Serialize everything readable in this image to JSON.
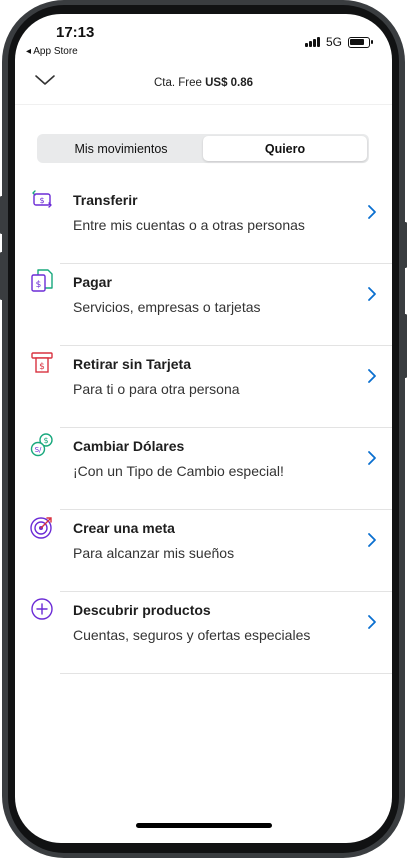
{
  "status_bar": {
    "time": "17:13",
    "back_app": "◂ App Store",
    "network": "5G"
  },
  "header": {
    "account_label": "Cta. Free",
    "account_amount": "US$ 0.86"
  },
  "tabs": [
    {
      "label": "Mis movimientos",
      "active": false
    },
    {
      "label": "Quiero",
      "active": true
    }
  ],
  "menu": [
    {
      "icon": "transfer-icon",
      "title": "Transferir",
      "subtitle": "Entre mis cuentas o a otras personas"
    },
    {
      "icon": "bill-icon",
      "title": "Pagar",
      "subtitle": "Servicios, empresas o tarjetas"
    },
    {
      "icon": "atm-icon",
      "title": "Retirar sin Tarjeta",
      "subtitle": "Para ti o para otra persona"
    },
    {
      "icon": "currency-exchange-icon",
      "title": "Cambiar Dólares",
      "subtitle": "¡Con un Tipo de Cambio especial!"
    },
    {
      "icon": "target-icon",
      "title": "Crear una meta",
      "subtitle": "Para alcanzar mis sueños"
    },
    {
      "icon": "plus-circle-icon",
      "title": "Descubrir productos",
      "subtitle": "Cuentas, seguros y ofertas especiales"
    }
  ],
  "colors": {
    "accent": "#0a6fcf",
    "icon_primary": "#6b2bd6",
    "icon_secondary": "#18a87d",
    "icon_red": "#d93240"
  }
}
